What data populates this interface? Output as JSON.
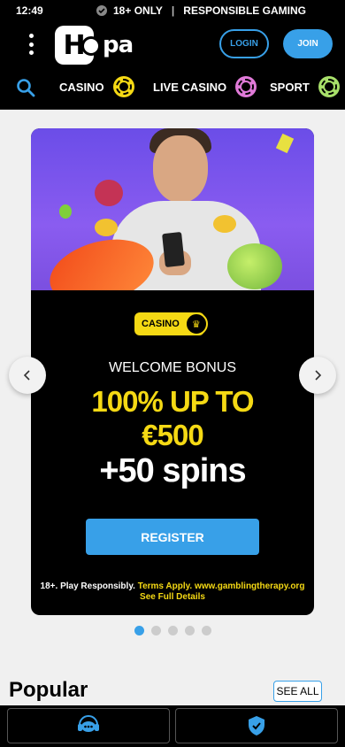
{
  "status_bar": {
    "time": "12:49",
    "age_label": "18+ ONLY",
    "separator": "|",
    "responsible_label": "RESPONSIBLE GAMING"
  },
  "header": {
    "logo_first": "H",
    "logo_rest": "pa",
    "login_label": "LOGIN",
    "join_label": "JOIN"
  },
  "nav": {
    "items": [
      {
        "label": "CASINO",
        "chip_color": "#f5d914"
      },
      {
        "label": "LIVE CASINO",
        "chip_color": "#e07ad8"
      },
      {
        "label": "SPORT",
        "chip_color": "#a8e06a"
      }
    ]
  },
  "banner": {
    "badge_label": "CASINO",
    "title": "WELCOME BONUS",
    "line1": "100% UP TO",
    "line2": "€500",
    "line3": "+50 spins",
    "register_label": "REGISTER",
    "legal_prefix": "18+. Play Responsibly.",
    "legal_terms": "Terms Apply. www.gamblingtherapy.org",
    "legal_details": "See Full Details"
  },
  "carousel": {
    "slide_count": 5,
    "active_index": 0
  },
  "popular": {
    "heading": "Popular",
    "see_all_label": "SEE ALL"
  },
  "colors": {
    "accent": "#38a0e8",
    "highlight": "#f5d914",
    "background": "#f0f0f0"
  }
}
